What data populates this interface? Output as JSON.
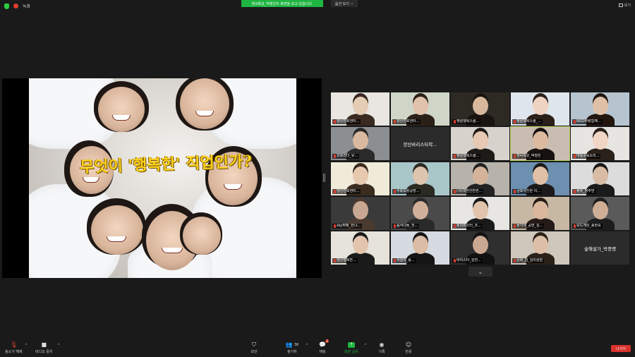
{
  "top_bar": {
    "recording_label": "녹화",
    "share_banner": "엔씨특강_박철민의 화면을 보고 있습니다.",
    "view_options": "옵션 보기",
    "view_toggle": "보기"
  },
  "slide": {
    "title": "무엇이 '행복한' 직업인가?"
  },
  "participants": [
    {
      "name": "양산진로센터..."
    },
    {
      "name": "양산진로센터..."
    },
    {
      "name": "햇살행복스쿨..."
    },
    {
      "name": "햇살행복스쿨_..."
    },
    {
      "name": "NGO하랑함께..."
    },
    {
      "name": "코로리더_유..."
    },
    {
      "name": "양산바리스타학..."
    },
    {
      "name": "햇살행복스쿨..."
    },
    {
      "name": "엔씨특강_박철민"
    },
    {
      "name": "마을교육소리..."
    },
    {
      "name": "양산진로센터..."
    },
    {
      "name": "수로도랑공방..."
    },
    {
      "name": "(사)대한안전연..."
    },
    {
      "name": "금호사진관 이..."
    },
    {
      "name": "플롯_정주연"
    },
    {
      "name": "sky뷔페_한나..."
    },
    {
      "name": "음식나눔_천..."
    },
    {
      "name": "토이미스터_조..."
    },
    {
      "name": "꽃가게_공방_김..."
    },
    {
      "name": "보드게임_송현숙"
    },
    {
      "name": "양산행복한..."
    },
    {
      "name": "서원의_송..."
    },
    {
      "name": "바리스타_김연..."
    },
    {
      "name": "문화_김_심리상담"
    },
    {
      "name": "숲해설가_박종명"
    }
  ],
  "toolbar": {
    "unmute": "음소거 해제",
    "stop_video": "비디오 중지",
    "security": "보안",
    "participants": "참가자",
    "participants_count": "36",
    "chat": "채팅",
    "chat_badge": "2",
    "share_screen": "화면 공유",
    "record": "기록",
    "reactions": "반응",
    "leave": "나가기"
  },
  "colors": {
    "accent_green": "#1fb541",
    "leave_red": "#d9322c",
    "active_outline": "#b3d45b"
  }
}
